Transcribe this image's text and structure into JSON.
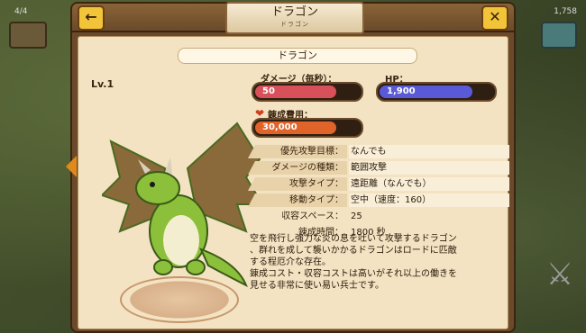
{
  "hud": {
    "left_count": "4/4",
    "right_count": "1,758"
  },
  "header": {
    "title": "ドラゴン",
    "subtitle": "ドラゴン"
  },
  "unit": {
    "name": "ドラゴン",
    "level": "Lv.1"
  },
  "stats": {
    "damage_label": "ダメージ（毎秒）：",
    "damage_value": "50",
    "damage_fraction": 0.78,
    "hp_label": "HP：",
    "hp_value": "1,900",
    "hp_fraction": 0.82,
    "cost_label": "錬成費用：",
    "cost_value": "30,000",
    "cost_fraction": 0.78
  },
  "info": [
    {
      "key": "優先攻撃目標：",
      "value": "なんでも"
    },
    {
      "key": "ダメージの種類：",
      "value": "範囲攻撃"
    },
    {
      "key": "攻撃タイプ：",
      "value": "遠距離（なんでも）"
    },
    {
      "key": "移動タイプ：",
      "value": "空中（速度：160）"
    },
    {
      "key": "収容スペース：",
      "value": "25"
    },
    {
      "key": "錬成時間：",
      "value": "1800 秒"
    }
  ],
  "description": [
    "空を飛行し強力な炎の息を吐いて攻撃するドラゴン",
    "、群れを成して襲いかかるドラゴンはロードに匹敵",
    "する程厄介な存在。",
    "錬成コスト・収容コストは高いがそれ以上の働きを",
    "見せる非常に使い易い兵士です。"
  ],
  "colors": {
    "damage_bar": "#d8505a",
    "hp_bar": "#5a5ad8",
    "cost_bar": "#e0642a"
  },
  "icons": [
    "back-arrow-icon",
    "close-icon",
    "heart-icon",
    "crossed-swords-icon",
    "nav-left-arrow-icon"
  ]
}
